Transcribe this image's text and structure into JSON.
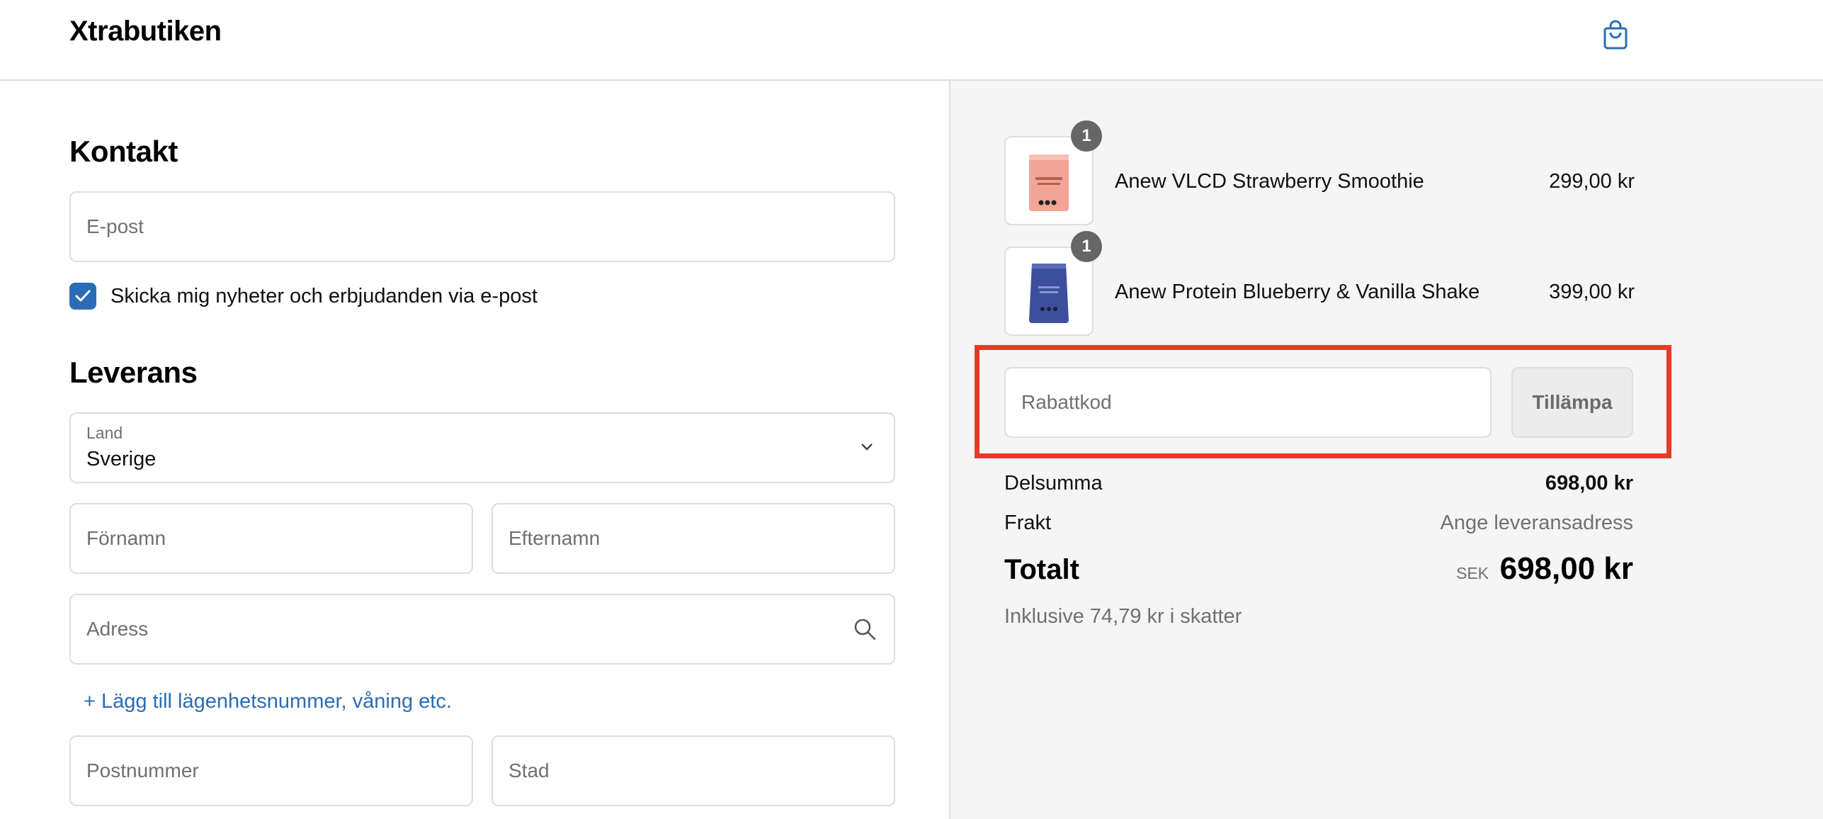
{
  "header": {
    "brand": "Xtrabutiken",
    "cart_icon": "shopping-bag-icon",
    "accent_color": "#2a6db6"
  },
  "contact": {
    "heading": "Kontakt",
    "email_placeholder": "E-post",
    "newsletter_checked": true,
    "newsletter_label": "Skicka mig nyheter och erbjudanden via e-post"
  },
  "delivery": {
    "heading": "Leverans",
    "country_label": "Land",
    "country_value": "Sverige",
    "first_name_placeholder": "Förnamn",
    "last_name_placeholder": "Efternamn",
    "address_placeholder": "Adress",
    "add_apartment_link": "+ Lägg till lägenhetsnummer, våning etc.",
    "postal_code_placeholder": "Postnummer",
    "city_placeholder": "Stad"
  },
  "order": {
    "items": [
      {
        "name": "Anew VLCD Strawberry Smoothie",
        "price": "299,00 kr",
        "quantity": "1"
      },
      {
        "name": "Anew Protein Blueberry & Vanilla Shake",
        "price": "399,00 kr",
        "quantity": "1"
      }
    ],
    "discount_placeholder": "Rabattkod",
    "apply_label": "Tillämpa",
    "subtotal_label": "Delsumma",
    "subtotal_value": "698,00 kr",
    "shipping_label": "Frakt",
    "shipping_value": "Ange leveransadress",
    "total_label": "Totalt",
    "currency": "SEK",
    "total_value": "698,00 kr",
    "tax_note": "Inklusive 74,79 kr i skatter",
    "highlight_color": "#e63b28"
  }
}
